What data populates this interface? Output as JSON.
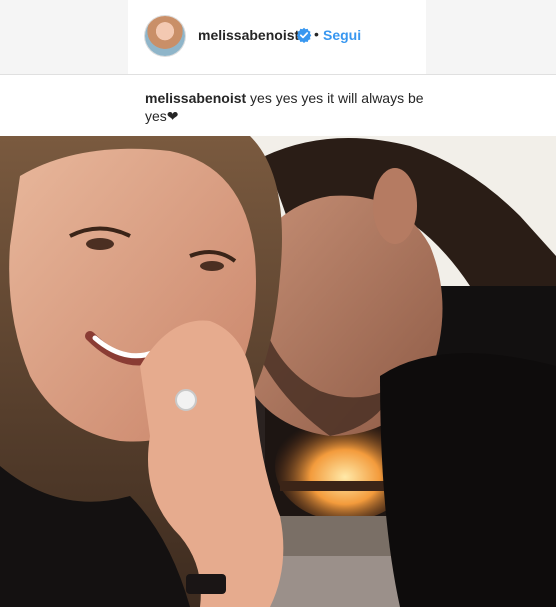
{
  "post": {
    "username": "melissabenoist",
    "follow_label": "Segui",
    "separator": "•",
    "caption_username": "melissabenoist",
    "caption_text": "yes yes yes it will always be yes❤"
  },
  "colors": {
    "link": "#3897f0",
    "verified": "#3897f0",
    "text": "#262626"
  },
  "icons": {
    "verified": "verified-badge-icon"
  }
}
